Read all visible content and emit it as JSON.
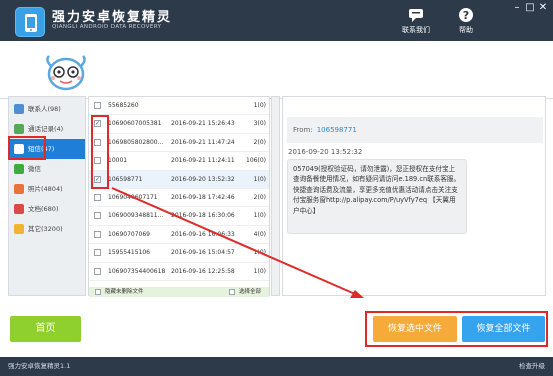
{
  "app": {
    "title": "强力安卓恢复精灵",
    "subtitle": "QIANGLI ANDROID DATA RECOVERY",
    "contact_label": "联系我们",
    "help_label": "帮助"
  },
  "sidebar": {
    "items": [
      {
        "label": "联系人(98)",
        "color": "#4f8fd1"
      },
      {
        "label": "通话记录(4)",
        "color": "#58a85a"
      },
      {
        "label": "短信(47)",
        "color": "#ffffff"
      },
      {
        "label": "微信",
        "color": "#3aad3a"
      },
      {
        "label": "照片(4804)",
        "color": "#e8743b"
      },
      {
        "label": "文档(680)",
        "color": "#d94a4a"
      },
      {
        "label": "其它(3200)",
        "color": "#f0b430"
      }
    ]
  },
  "messages": [
    {
      "number": "55685260",
      "date": "",
      "count": "1(0)",
      "checked": false
    },
    {
      "number": "10690607005381",
      "date": "2016-09-21 15:26:43",
      "count": "3(0)",
      "checked": true
    },
    {
      "number": "1069805802800...",
      "date": "2016-09-21 11:47:24",
      "count": "2(0)",
      "checked": false
    },
    {
      "number": "10001",
      "date": "2016-09-21 11:24:11",
      "count": "106(0)",
      "checked": false
    },
    {
      "number": "106598771",
      "date": "2016-09-20 13:52:32",
      "count": "1(0)",
      "checked": true
    },
    {
      "number": "1069040607171",
      "date": "2016-09-18 17:42:46",
      "count": "2(0)",
      "checked": false
    },
    {
      "number": "1069009348811...",
      "date": "2016-09-18 16:30:06",
      "count": "1(0)",
      "checked": false
    },
    {
      "number": "10690707069",
      "date": "2016-09-16 16:06:33",
      "count": "4(0)",
      "checked": false
    },
    {
      "number": "15955415106",
      "date": "2016-09-16 15:04:57",
      "count": "1(0)",
      "checked": false
    },
    {
      "number": "106907354400618",
      "date": "2016-09-16 12:25:58",
      "count": "1(0)",
      "checked": false
    }
  ],
  "list_footer": {
    "hide_deleted": "隐藏未删除文件",
    "select_all": "选择全部"
  },
  "detail": {
    "from_label": "From:",
    "from_value": "106598771",
    "time": "2016-09-20 13:52:32",
    "body": "057049(授权验证码，请勿泄露)，您正授权在支付宝上查询备餐使用情况，如有疑问请访问e.189.cn联系客服。快捷查询话费及流量，享更多充值优惠活动请点击关注支付宝服务窗http://p.alipay.com/P/uyVfy7eq 【天翼用户中心】"
  },
  "actions": {
    "home": "首页",
    "recover_selected": "恢复选中文件",
    "recover_all": "恢复全部文件"
  },
  "status": {
    "version": "强力安卓恢复精灵1.1",
    "update": "检查升级"
  }
}
